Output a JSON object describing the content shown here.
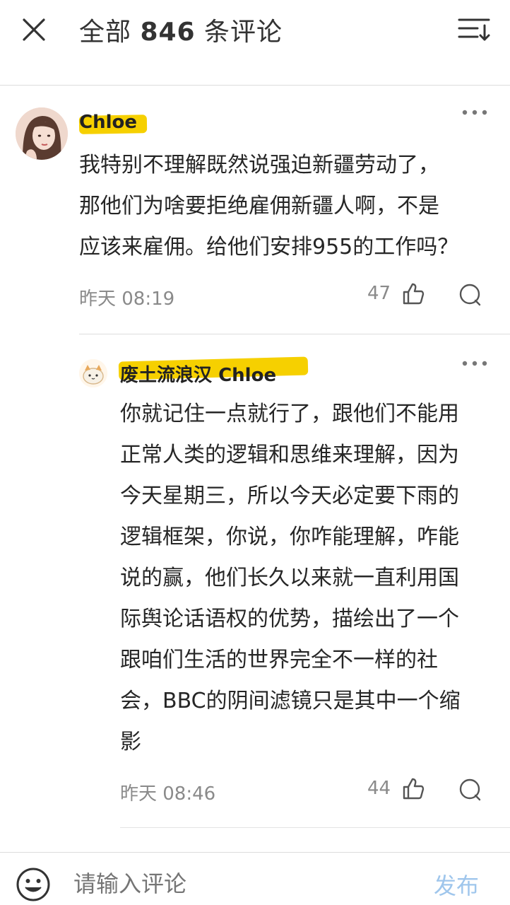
{
  "header": {
    "title_prefix": "全部 ",
    "count": "846",
    "title_suffix": " 条评论",
    "close_icon": "close-icon",
    "sort_icon": "sort-icon"
  },
  "comments": [
    {
      "username": "Chloe",
      "avatar": "avatar-illustrated-woman",
      "lines": [
        "我特别不理解既然说强迫新疆劳动了，",
        "那他们为啥要拒绝雇佣新疆人啊，不是",
        "应该来雇佣。给他们安排955的工作吗？"
      ],
      "time": "昨天 08:19",
      "likes": "47"
    }
  ],
  "replies": [
    {
      "username": "废土流浪汉",
      "reply_to": "Chloe",
      "avatar": "avatar-cartoon-cat",
      "lines": [
        "你就记住一点就行了，跟他们不能用",
        "正常人类的逻辑和思维来理解，因为",
        "今天星期三，所以今天必定要下雨的",
        "逻辑框架，你说，你咋能理解，咋能",
        "说的赢，他们长久以来就一直利用国",
        "际舆论话语权的优势，描绘出了一个",
        "跟咱们生活的世界完全不一样的社",
        "会，BBC的阴间滤镜只是其中一个缩",
        "影"
      ],
      "time": "昨天 08:46",
      "likes": "44"
    }
  ],
  "input": {
    "placeholder": "请输入评论",
    "publish_label": "发布"
  },
  "colors": {
    "highlight": "#f6d000",
    "publish_disabled": "#9fc6ec",
    "meta_gray": "#8a8a8a"
  }
}
